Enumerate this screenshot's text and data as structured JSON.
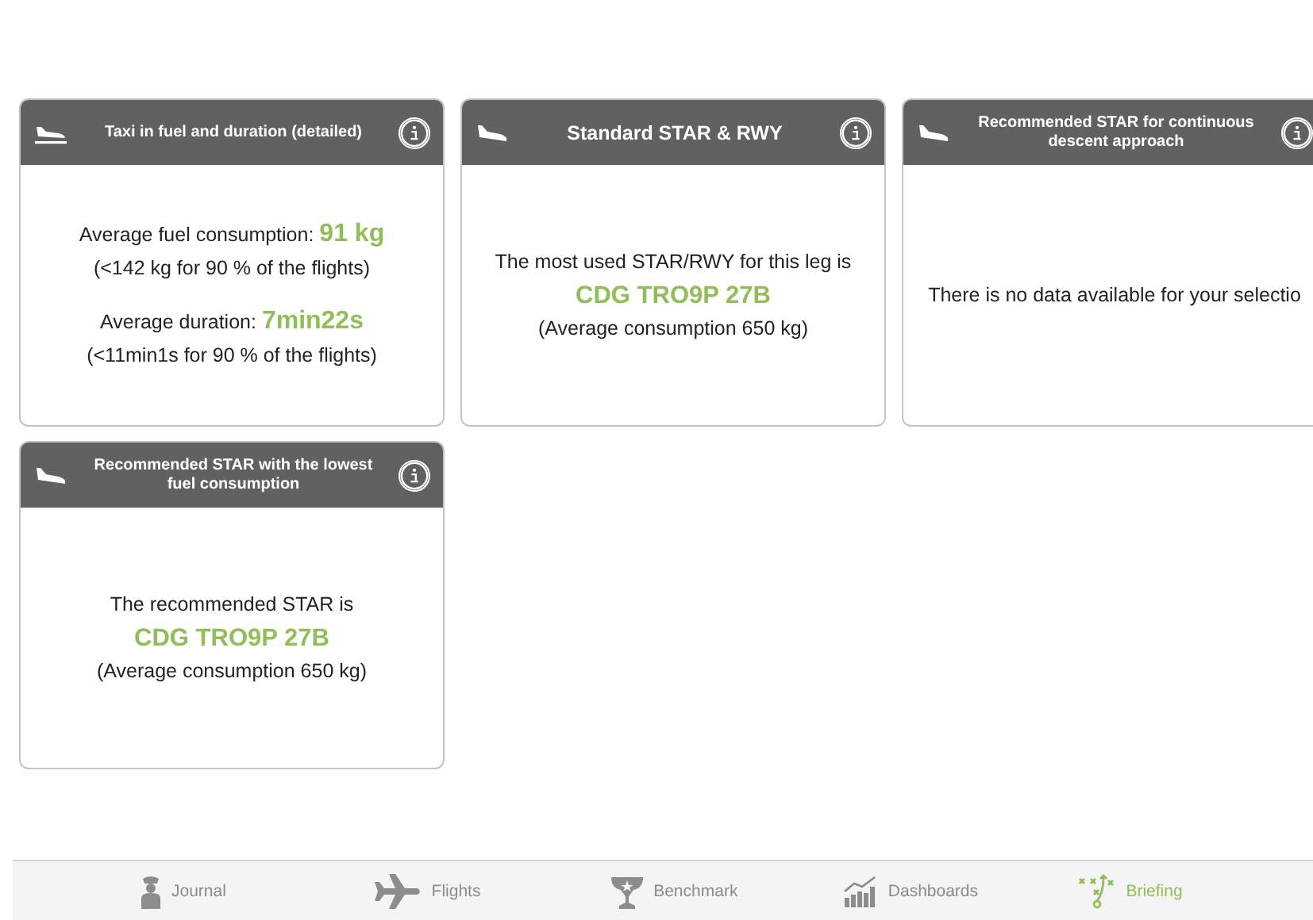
{
  "cards": [
    {
      "title": "Taxi in fuel and duration (detailed)",
      "kind": "taxi",
      "lines": [
        {
          "kind": "value",
          "text": "Average fuel consumption:",
          "value": "91 kg"
        },
        {
          "kind": "text",
          "text": "(<142 kg for 90 % of the flights)"
        },
        {
          "kind": "gap"
        },
        {
          "kind": "value",
          "text": "Average duration:",
          "value": "7min22s"
        },
        {
          "kind": "text",
          "text": "(<11min1s for 90 % of the flights)"
        }
      ]
    },
    {
      "title": "Standard STAR & RWY",
      "kind": "landing",
      "lines": [
        {
          "kind": "text",
          "text": "The most used STAR/RWY for this leg is"
        },
        {
          "kind": "highlight",
          "text": "CDG TRO9P 27B"
        },
        {
          "kind": "text",
          "text": "(Average consumption 650 kg)"
        }
      ]
    },
    {
      "title": "Recommended STAR for continuous descent approach",
      "kind": "landing",
      "lines": [
        {
          "kind": "text",
          "text": "There is no data available for your selectio"
        }
      ]
    },
    {
      "title": "Recommended STAR with the lowest fuel consumption",
      "kind": "landing",
      "lines": [
        {
          "kind": "text",
          "text": "The recommended STAR is"
        },
        {
          "kind": "highlight",
          "text": "CDG TRO9P 27B"
        },
        {
          "kind": "text",
          "text": "(Average consumption 650 kg)"
        }
      ]
    }
  ],
  "tab_bar": [
    {
      "label": "Journal",
      "kind": "pilot",
      "selected": false
    },
    {
      "label": "Flights",
      "kind": "plane",
      "selected": false
    },
    {
      "label": "Benchmark",
      "kind": "trophy",
      "selected": false
    },
    {
      "label": "Dashboards",
      "kind": "chart",
      "selected": false
    },
    {
      "label": "Briefing",
      "kind": "play",
      "selected": true
    }
  ]
}
